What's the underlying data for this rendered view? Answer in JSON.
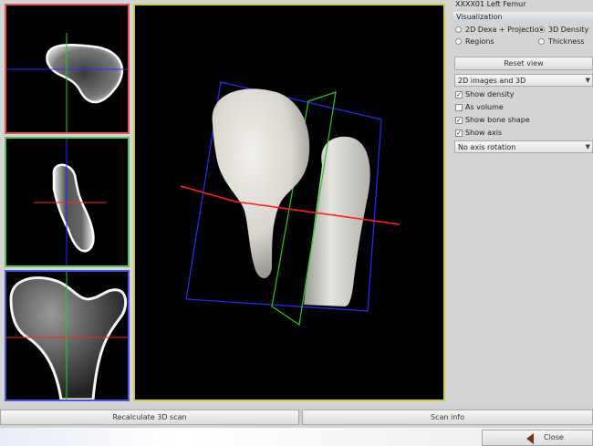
{
  "panel": {
    "title": "XXXX01 Left Femur",
    "visualization_header": "Visualization",
    "options": [
      {
        "label": "2D Dexa + Projection",
        "selected": false
      },
      {
        "label": "3D Density",
        "selected": true
      },
      {
        "label": "Regions",
        "selected": false
      },
      {
        "label": "Thickness",
        "selected": false
      }
    ],
    "reset_view": "Reset view",
    "display_mode": "2D images and 3D",
    "checks": [
      {
        "label": "Show density",
        "checked": true
      },
      {
        "label": "As volume",
        "checked": false
      },
      {
        "label": "Show bone shape",
        "checked": true
      },
      {
        "label": "Show axis",
        "checked": true
      }
    ],
    "rotation_mode": "No axis rotation"
  },
  "buttons": {
    "recalculate": "Recalculate 3D scan",
    "scan_info": "Scan info",
    "close": "Close"
  },
  "colors": {
    "axial_border": "#e05555",
    "coronal_border": "#55c055",
    "sagittal_border": "#4a55d8",
    "view3d_border": "#c9c94a"
  }
}
